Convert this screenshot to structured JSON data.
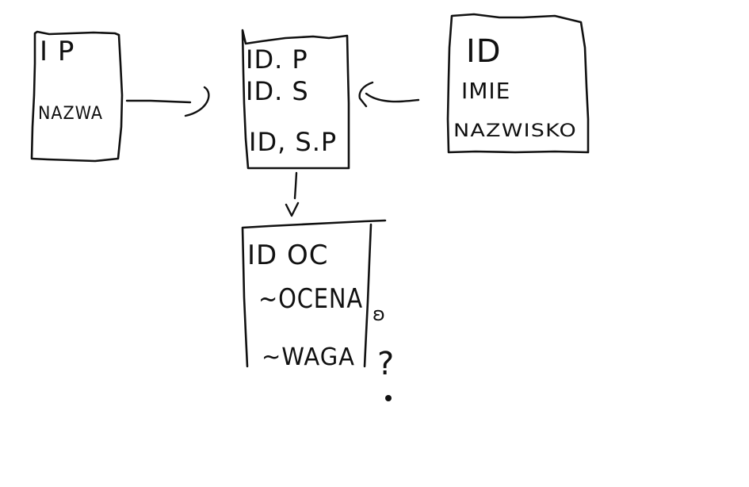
{
  "entities": {
    "left": {
      "fields": [
        "I P",
        "NAZWA"
      ]
    },
    "center": {
      "fields": [
        "ID. P",
        "ID. S",
        "ID, S.P"
      ]
    },
    "right": {
      "fields": [
        "ID",
        "IMIE",
        "NAZWISKO"
      ]
    },
    "bottom": {
      "fields": [
        "ID OC",
        "~OCENA",
        "~WAGA"
      ]
    }
  },
  "annotations": {
    "question_mark": "?"
  },
  "colors": {
    "ink": "#111111",
    "background": "#ffffff"
  }
}
